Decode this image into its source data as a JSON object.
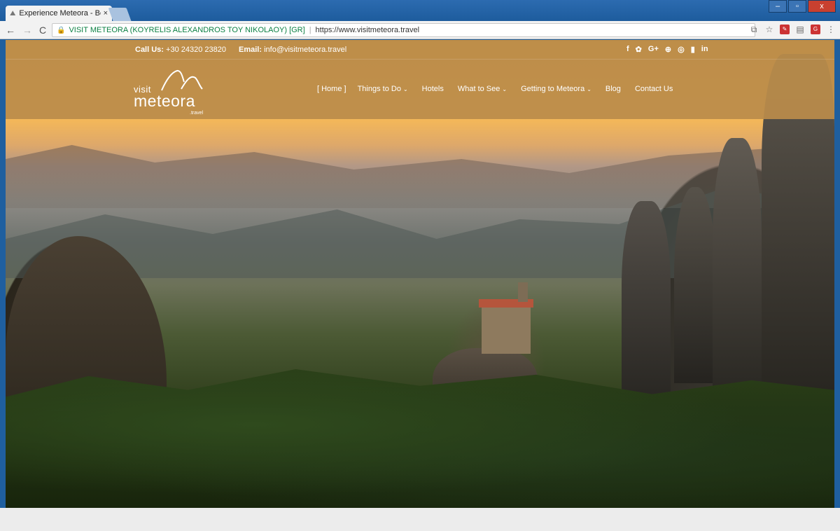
{
  "browser": {
    "tab_title": "Experience Meteora - Bo",
    "tab_close": "×",
    "nav_back": "←",
    "nav_forward": "→",
    "nav_reload": "C",
    "cert_label": "VISIT METEORA (KOYRELIS ALEXANDROS TOY NIKOLAOY) [GR]",
    "separator": "|",
    "url": "https://www.visitmeteora.travel",
    "window_min": "–",
    "window_max": "▫",
    "window_close": "x"
  },
  "topbar": {
    "call_label": "Call Us:",
    "call_number": "+30 24320 23820",
    "email_label": "Email:",
    "email_value": "info@visitmeteora.travel",
    "social": [
      "f",
      "♥",
      "G+",
      "⊕",
      "◎",
      "▮",
      "in"
    ]
  },
  "logo": {
    "visit": "visit",
    "meteora": "meteora",
    "travel": ".travel"
  },
  "menu": {
    "home": "[ Home ]",
    "things_to_do": "Things to Do",
    "hotels": "Hotels",
    "what_to_see": "What to See",
    "getting_to_meteora": "Getting to Meteora",
    "blog": "Blog",
    "contact_us": "Contact Us",
    "chevron": "⌄"
  },
  "colors": {
    "header_overlay": "#ba8c4a",
    "chrome_frame": "#1f5f9f",
    "secure_green": "#0b8043"
  }
}
